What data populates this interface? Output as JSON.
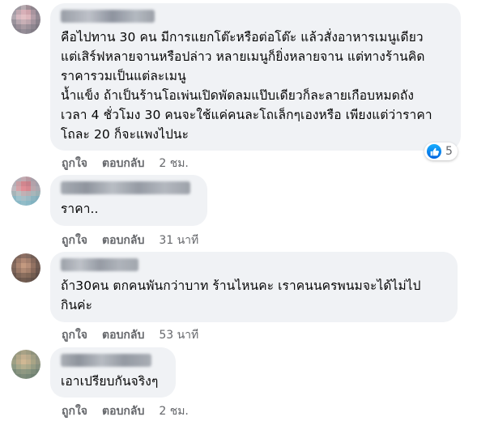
{
  "colors": {
    "bubble": "#f0f2f5",
    "secondary_text": "#65676b",
    "like_blue": "#1877f2"
  },
  "labels": {
    "like": "ถูกใจ",
    "reply": "ตอบกลับ"
  },
  "comments": [
    {
      "author_blurred": true,
      "text": "คือไปทาน 30 คน มีการแยกโต๊ะหรือต่อโต๊ะ แล้วสั่งอาหารเมนูเดียว\nแต่เสิร์ฟหลายจานหรือปล่าว หลายเมนูก็ยิ่งหลายจาน แต่ทางร้านคิด\nราคารวมเป็นแต่ละเมนู\nน้ำแข็ง ถ้าเป็นร้านโอเพ่นเปิดพัดลมแป๊บเดียวก็ละลายเกือบหมดถัง\nเวลา 4 ชั่วโมง 30 คนจะใช้แค่คนละโถเล็กๆเองหรือ เพียงแต่ว่าราคา\nโถละ 20 ก็จะแพงไปนะ",
      "time": "2 ชม.",
      "reaction_icon": "like-icon",
      "reaction_count": "5"
    },
    {
      "author_blurred": true,
      "text": "ราคา..",
      "time": "31 นาที"
    },
    {
      "author_blurred": true,
      "text": "ถ้า30คน ตกคนพันกว่าบาท ร้านไหนคะ เราคนนครพนมจะได้ไม่ไป\nกินค่ะ",
      "time": "53 นาที"
    },
    {
      "author_blurred": true,
      "text": "เอาเปรียบกันจริงๆ",
      "time": "2 ชม."
    }
  ]
}
